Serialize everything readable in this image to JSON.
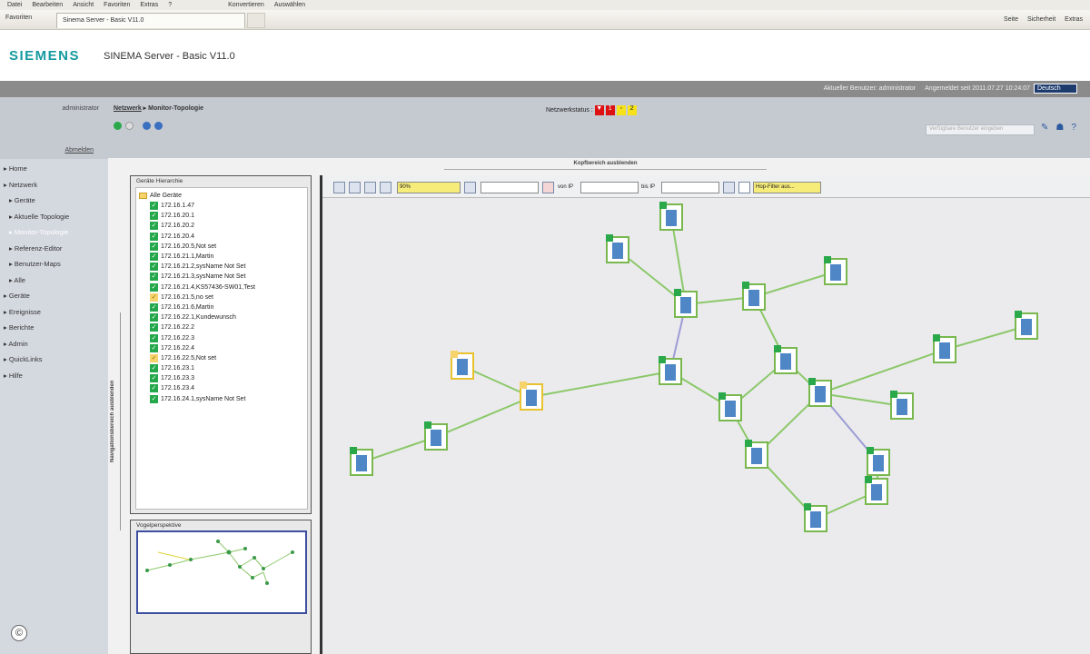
{
  "browser": {
    "menu": [
      "Datei",
      "Bearbeiten",
      "Ansicht",
      "Favoriten",
      "Extras",
      "?"
    ],
    "menu_right": [
      "Konvertieren",
      "Auswählen"
    ],
    "favorites": "Favoriten",
    "tab_title": "Sinema Server - Basic V11.0",
    "tools": [
      "Seite",
      "Sicherheit",
      "Extras"
    ]
  },
  "header": {
    "logo": "SIEMENS",
    "title": "SINEMA Server - Basic V11.0"
  },
  "userbar": {
    "current_user": "Aktueller Benutzer: administrator",
    "logged_in": "Angemeldet seit 2011.07.27 10:24:07",
    "language": "Deutsch"
  },
  "left": {
    "user": "administrator",
    "logout": "Abmelden",
    "nav": [
      {
        "label": "Home",
        "sub": false,
        "active": false
      },
      {
        "label": "Netzwerk",
        "sub": false,
        "active": false
      },
      {
        "label": "Geräte",
        "sub": true,
        "active": false
      },
      {
        "label": "Aktuelle Topologie",
        "sub": true,
        "active": false
      },
      {
        "label": "Monitor-Topologie",
        "sub": true,
        "active": true
      },
      {
        "label": "Referenz-Editor",
        "sub": true,
        "active": false
      },
      {
        "label": "Benutzer-Maps",
        "sub": true,
        "active": false
      },
      {
        "label": "Alle",
        "sub": true,
        "active": false
      },
      {
        "label": "Geräte",
        "sub": false,
        "active": false
      },
      {
        "label": "Ereignisse",
        "sub": false,
        "active": false
      },
      {
        "label": "Berichte",
        "sub": false,
        "active": false
      },
      {
        "label": "Admin",
        "sub": false,
        "active": false
      },
      {
        "label": "QuickLinks",
        "sub": false,
        "active": false
      },
      {
        "label": "Hilfe",
        "sub": false,
        "active": false
      }
    ]
  },
  "topbar": {
    "breadcrumb_root": "Netzwerk",
    "breadcrumb_current": "Monitor-Topologie",
    "netstatus_label": "Netzwerkstatus :",
    "status_red": "1",
    "status_yellow": "2",
    "search_placeholder": "Verfügbare Benutzer eingeben"
  },
  "panel": {
    "hide_header": "Kopfbereich ausblenden",
    "hide_nav": "Navigationsbereich ausblenden",
    "tree_title": "Geräte Hierarchie",
    "tree_root": "Alle Geräte",
    "tree": [
      {
        "label": "172.16.1.47",
        "status": "ok"
      },
      {
        "label": "172.16.20.1",
        "status": "ok"
      },
      {
        "label": "172.16.20.2",
        "status": "ok"
      },
      {
        "label": "172.16.20.4",
        "status": "ok"
      },
      {
        "label": "172.16.20.5,Not set",
        "status": "ok"
      },
      {
        "label": "172.16.21.1,Martin",
        "status": "ok"
      },
      {
        "label": "172.16.21.2,sysName Not Set",
        "status": "ok"
      },
      {
        "label": "172.16.21.3,sysName Not Set",
        "status": "ok"
      },
      {
        "label": "172.16.21.4,KS57436-SW01,Test",
        "status": "ok"
      },
      {
        "label": "172.16.21.5,no set",
        "status": "warn"
      },
      {
        "label": "172.16.21.6,Martin",
        "status": "ok"
      },
      {
        "label": "172.16.22.1,Kundewunsch",
        "status": "ok"
      },
      {
        "label": "172.16.22.2",
        "status": "ok"
      },
      {
        "label": "172.16.22.3",
        "status": "ok"
      },
      {
        "label": "172.16.22.4",
        "status": "ok"
      },
      {
        "label": "172.16.22.5,Not set",
        "status": "warn"
      },
      {
        "label": "172.16.23.1",
        "status": "ok"
      },
      {
        "label": "172.16.23.3",
        "status": "ok"
      },
      {
        "label": "172.16.23.4",
        "status": "ok"
      },
      {
        "label": "172.16.24.1,sysName Not Set",
        "status": "ok"
      }
    ],
    "bird_title": "Vogelperspektive",
    "zoom": "90%",
    "from_ip": "von IP",
    "to_ip": "bis IP",
    "hop_filter": "Hop-Filter aus..."
  },
  "copyright": "©"
}
